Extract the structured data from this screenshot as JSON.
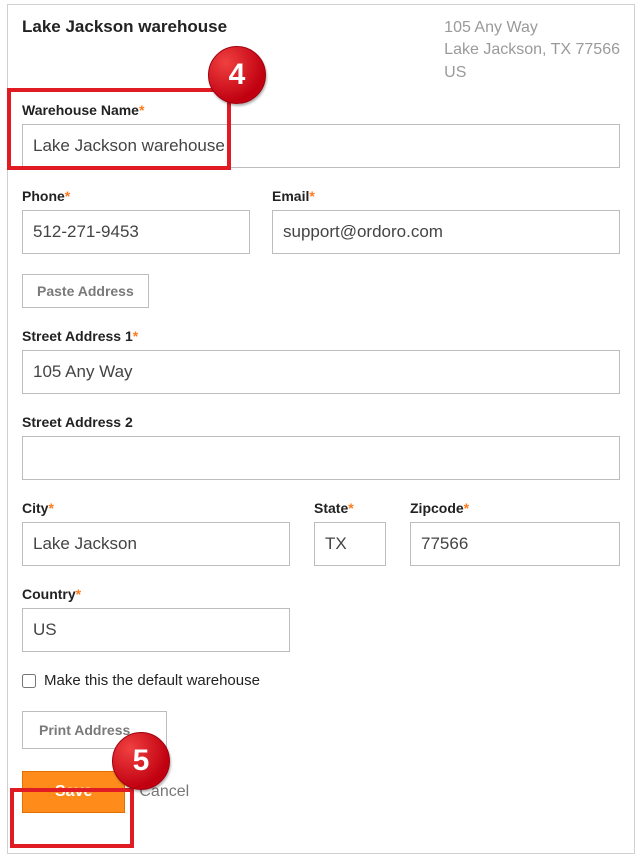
{
  "header": {
    "title": "Lake Jackson warehouse",
    "addr_line1": "105 Any Way",
    "addr_line2": "Lake Jackson, TX 77566",
    "addr_line3": "US"
  },
  "fields": {
    "warehouse_name": {
      "label": "Warehouse Name",
      "value": "Lake Jackson warehouse"
    },
    "phone": {
      "label": "Phone",
      "value": "512-271-9453"
    },
    "email": {
      "label": "Email",
      "value": "support@ordoro.com"
    },
    "street1": {
      "label": "Street Address 1",
      "value": "105 Any Way"
    },
    "street2": {
      "label": "Street Address 2",
      "value": ""
    },
    "city": {
      "label": "City",
      "value": "Lake Jackson"
    },
    "state": {
      "label": "State",
      "value": "TX"
    },
    "zip": {
      "label": "Zipcode",
      "value": "77566"
    },
    "country": {
      "label": "Country",
      "value": "US"
    }
  },
  "buttons": {
    "paste_address": "Paste Address",
    "print_address": "Print Address",
    "save": "Save",
    "cancel": "Cancel"
  },
  "checkbox": {
    "default_warehouse": "Make this the default warehouse"
  },
  "callouts": {
    "badge4": "4",
    "badge5": "5"
  }
}
